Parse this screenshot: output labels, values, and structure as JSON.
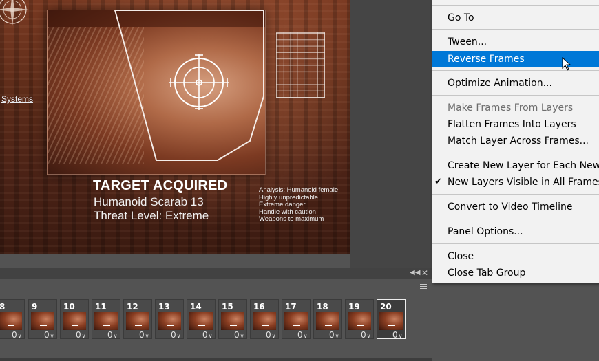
{
  "canvas": {
    "link_text": "Systems",
    "headline": "TARGET ACQUIRED",
    "subline1": "Humanoid Scarab 13",
    "subline2": "Threat Level: Extreme",
    "analysis": [
      "Analysis: Humanoid female",
      "Highly unpredictable",
      "Extreme danger",
      "Handle with caution",
      "Weapons to maximum"
    ]
  },
  "animation_panel": {
    "collapse_icon": "double-chevron-left-icon",
    "close_icon": "close-icon",
    "menu_icon": "hamburger-menu-icon",
    "frames": [
      {
        "number": "8",
        "delay": "0"
      },
      {
        "number": "9",
        "delay": "0"
      },
      {
        "number": "10",
        "delay": "0"
      },
      {
        "number": "11",
        "delay": "0"
      },
      {
        "number": "12",
        "delay": "0"
      },
      {
        "number": "13",
        "delay": "0"
      },
      {
        "number": "14",
        "delay": "0"
      },
      {
        "number": "15",
        "delay": "0"
      },
      {
        "number": "16",
        "delay": "0"
      },
      {
        "number": "17",
        "delay": "0"
      },
      {
        "number": "18",
        "delay": "0"
      },
      {
        "number": "19",
        "delay": "0"
      },
      {
        "number": "20",
        "delay": "0"
      }
    ],
    "selected_frame": "20"
  },
  "context_menu": {
    "items": [
      {
        "label": "Go To",
        "enabled": true
      },
      {
        "label": "Tween...",
        "enabled": true
      },
      {
        "label": "Reverse Frames",
        "enabled": true,
        "highlighted": true
      },
      {
        "label": "Optimize Animation...",
        "enabled": true
      },
      {
        "label": "Make Frames From Layers",
        "enabled": false
      },
      {
        "label": "Flatten Frames Into Layers",
        "enabled": true
      },
      {
        "label": "Match Layer Across Frames...",
        "enabled": true
      },
      {
        "label": "Create New Layer for Each New Frame",
        "enabled": true
      },
      {
        "label": "New Layers Visible in All Frames",
        "enabled": true,
        "checked": true
      },
      {
        "label": "Convert to Video Timeline",
        "enabled": true
      },
      {
        "label": "Panel Options...",
        "enabled": true
      },
      {
        "label": "Close",
        "enabled": true
      },
      {
        "label": "Close Tab Group",
        "enabled": true
      }
    ],
    "check_glyph": "✔",
    "highlight_color": "#0078d7"
  }
}
